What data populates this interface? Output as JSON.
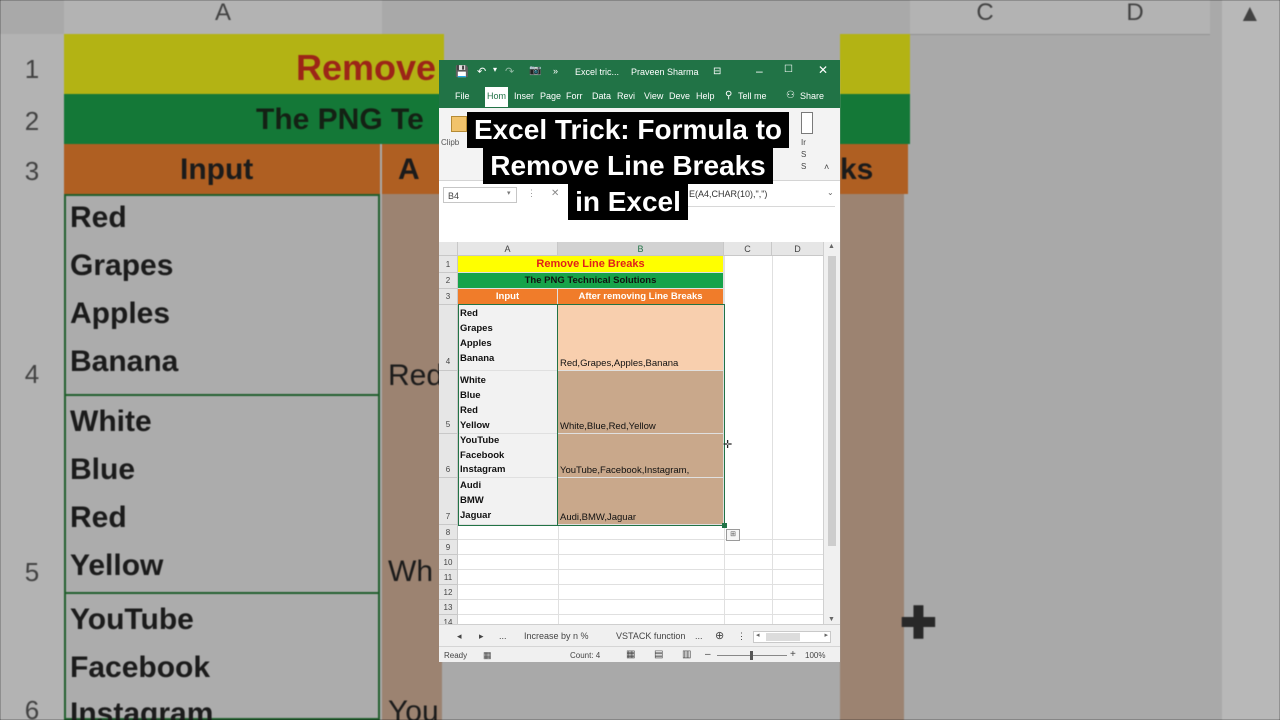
{
  "background": {
    "col_headers": [
      "A",
      "C",
      "D"
    ],
    "row_numbers": [
      "1",
      "2",
      "3",
      "4",
      "5",
      "6"
    ],
    "title_fragment": "Remove",
    "subtitle_fragment": "The PNG Te",
    "header_input": "Input",
    "header_b_fragment": "A",
    "header_right_fragment": "ks",
    "input_lines": [
      "Red",
      "Grapes",
      "Apples",
      "Banana",
      "White",
      "Blue",
      "Red",
      "Yellow",
      "YouTube",
      "Facebook",
      "Instagram"
    ],
    "b_fragments": [
      "Red",
      "Wh",
      "You"
    ]
  },
  "window": {
    "title": "Excel tric...",
    "user": "Praveen Sharma",
    "tabs": [
      "File",
      "Hom",
      "Inser",
      "Page",
      "Forr",
      "Data",
      "Revi",
      "View",
      "Deve",
      "Help"
    ],
    "tell_me": "Tell me",
    "share": "Share",
    "ribbon_fragment_clipboard": "Clipb",
    "name_box": "B4",
    "formula_fragment": "E(A4,CHAR(10),\",\")"
  },
  "caption": {
    "lines": [
      "Excel Trick: Formula to",
      "Remove Line Breaks",
      "in Excel"
    ]
  },
  "sheet": {
    "columns": [
      "A",
      "B",
      "C",
      "D"
    ],
    "rows": [
      "1",
      "2",
      "3",
      "4",
      "5",
      "6",
      "7",
      "8",
      "9",
      "10",
      "11",
      "12",
      "13",
      "14"
    ],
    "title": "Remove Line Breaks",
    "subtitle": "The PNG Technical Solutions",
    "header_input": "Input",
    "header_output": "After removing Line Breaks",
    "data": [
      {
        "input": [
          "Red",
          "Grapes",
          "Apples",
          "Banana"
        ],
        "output": "Red,Grapes,Apples,Banana"
      },
      {
        "input": [
          "White",
          "Blue",
          "Red",
          "Yellow"
        ],
        "output": "White,Blue,Red,Yellow"
      },
      {
        "input": [
          "YouTube",
          "Facebook",
          "Instagram"
        ],
        "output": "YouTube,Facebook,Instagram,"
      },
      {
        "input": [
          "Audi",
          "BMW",
          "Jaguar"
        ],
        "output": "Audi,BMW,Jaguar"
      }
    ],
    "colors": {
      "title_bg": "#ffff00",
      "title_fg": "#e0201a",
      "subtitle_bg": "#16a34a",
      "header_bg": "#f07c2a",
      "out_light": "#f8cfae",
      "out_dark": "#c9a88b",
      "excel_green": "#217346"
    }
  },
  "tabs_bar": {
    "sheet1": "Increase by n %",
    "sheet2": "VSTACK function",
    "more": "..."
  },
  "status": {
    "ready": "Ready",
    "count": "Count: 4",
    "zoom": "100%"
  }
}
